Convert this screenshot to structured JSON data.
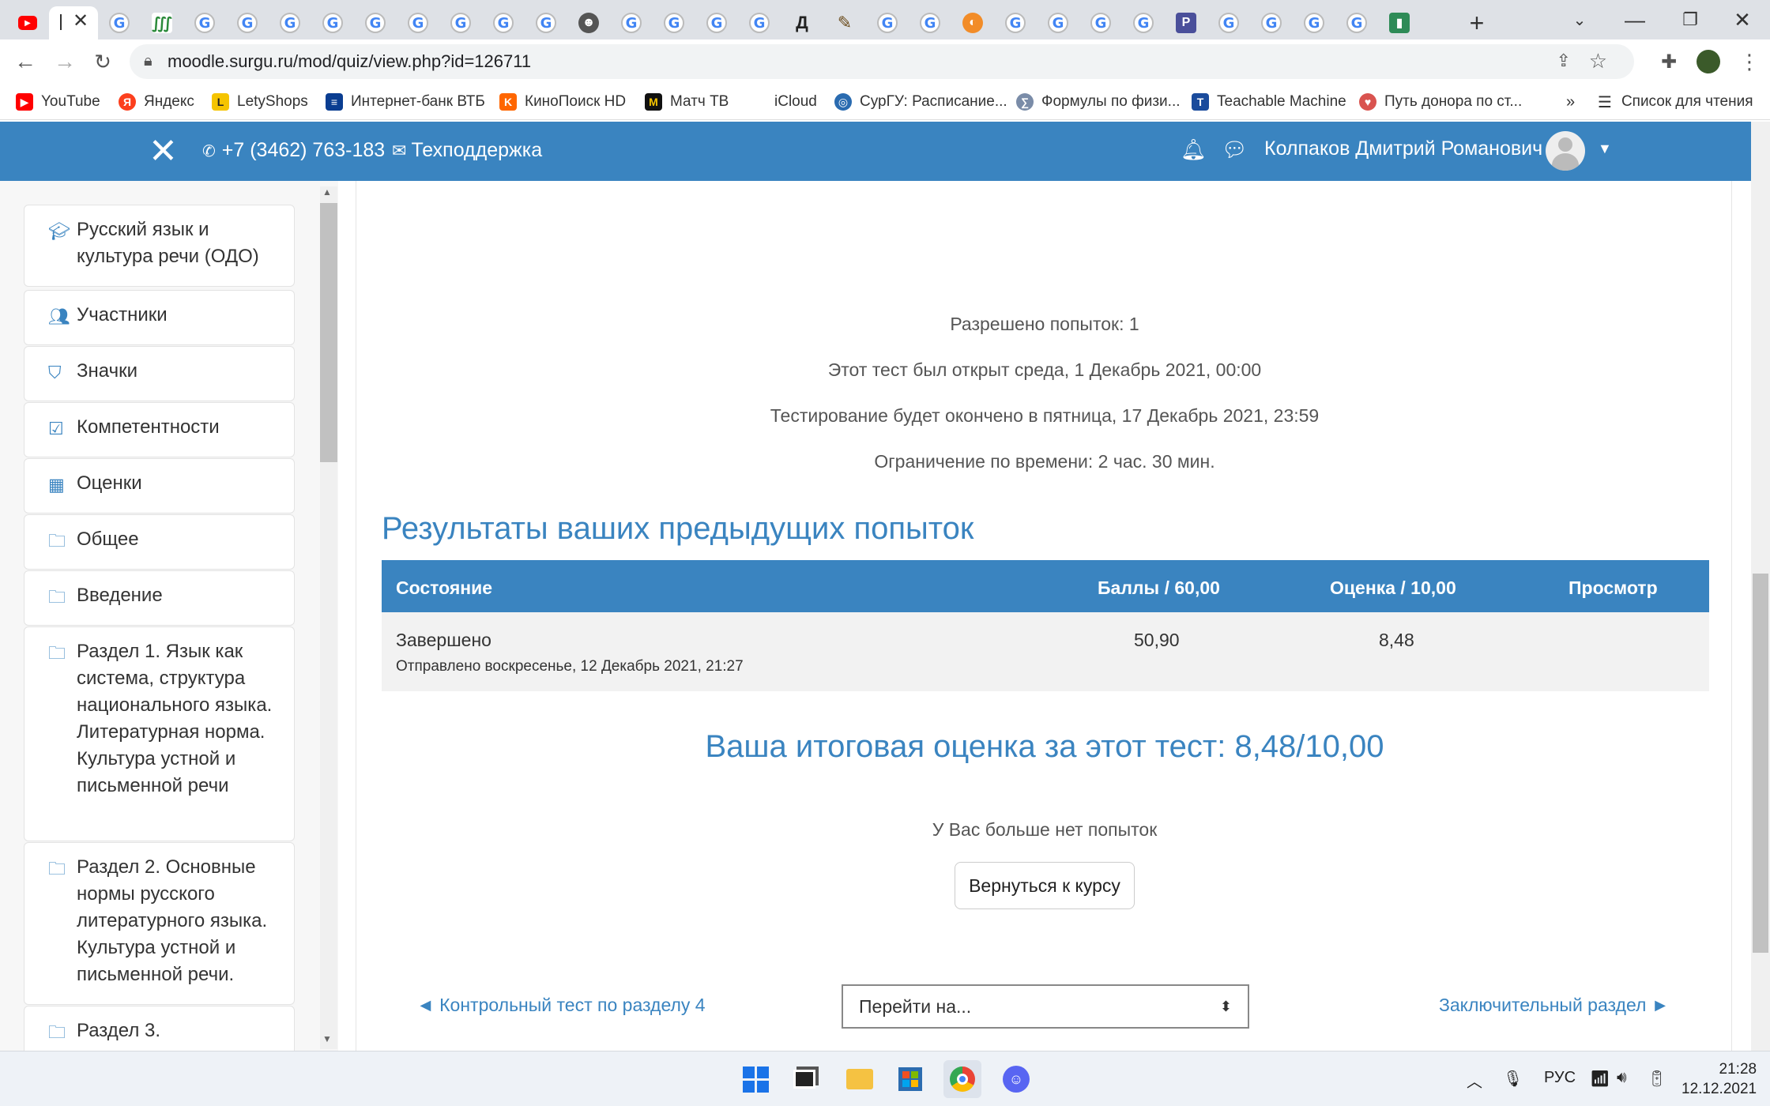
{
  "browser": {
    "url": "moodle.surgu.ru/mod/quiz/view.php?id=126711",
    "new_tab_label": "+"
  },
  "bookmarks": [
    {
      "label": "YouTube",
      "icon": "youtube-icon",
      "color": "#ff0000"
    },
    {
      "label": "Яндекс",
      "icon": "yandex-icon",
      "color": "#fc3f1d"
    },
    {
      "label": "LetyShops",
      "icon": "letyshops-icon",
      "color": "#f5c400"
    },
    {
      "label": "Интернет-банк ВТБ",
      "icon": "vtb-icon",
      "color": "#0a3d91"
    },
    {
      "label": "КиноПоиск HD",
      "icon": "kinopoisk-icon",
      "color": "#ff6600"
    },
    {
      "label": "Матч ТВ",
      "icon": "matchtv-icon",
      "color": "#111111"
    },
    {
      "label": "iCloud",
      "icon": "apple-icon",
      "color": "#666666"
    },
    {
      "label": "СурГУ: Расписание...",
      "icon": "surgu-icon",
      "color": "#2a6bb0"
    },
    {
      "label": "Формулы по физи...",
      "icon": "formula-icon",
      "color": "#7a8ca8"
    },
    {
      "label": "Teachable Machine",
      "icon": "tm-icon",
      "color": "#1a4b9c"
    },
    {
      "label": "Путь донора по ст...",
      "icon": "donor-icon",
      "color": "#d9534f"
    }
  ],
  "bookmarks_more": "»",
  "reading_list": "Список для чтения",
  "header": {
    "phone": "+7 (3462) 763-183",
    "support": "Техподдержка",
    "user_name": "Колпаков Дмитрий Романович"
  },
  "sidebar": {
    "items": [
      {
        "label": "Русский язык и культура речи (ОДО)",
        "icon": "graduation-cap-icon"
      },
      {
        "label": "Участники",
        "icon": "users-icon"
      },
      {
        "label": "Значки",
        "icon": "shield-icon"
      },
      {
        "label": "Компетентности",
        "icon": "checkbox-icon"
      },
      {
        "label": "Оценки",
        "icon": "table-icon"
      },
      {
        "label": "Общее",
        "icon": "folder-icon"
      },
      {
        "label": "Введение",
        "icon": "folder-icon"
      },
      {
        "label": "Раздел 1. Язык как система, структура национального языка. Литературная норма. Культура устной и письменной речи",
        "icon": "folder-icon"
      },
      {
        "label": "Раздел 2. Основные нормы русского литературного языка. Культура устной и письменной речи.",
        "icon": "folder-icon"
      },
      {
        "label": "Раздел 3.",
        "icon": "folder-icon"
      }
    ]
  },
  "quiz_info": {
    "attempts_allowed": "Разрешено попыток: 1",
    "opened": "Этот тест был открыт среда, 1 Декабрь 2021, 00:00",
    "closes": "Тестирование будет окончено в пятница, 17 Декабрь 2021, 23:59",
    "time_limit": "Ограничение по времени: 2 час. 30 мин."
  },
  "results": {
    "heading": "Результаты ваших предыдущих попыток",
    "columns": [
      "Состояние",
      "Баллы / 60,00",
      "Оценка / 10,00",
      "Просмотр"
    ],
    "rows": [
      {
        "state": "Завершено",
        "submitted": "Отправлено воскресенье, 12 Декабрь 2021, 21:27",
        "marks": "50,90",
        "grade": "8,48",
        "review": ""
      }
    ]
  },
  "final_grade": "Ваша итоговая оценка за этот тест: 8,48/10,00",
  "no_more_attempts": "У Вас больше нет попыток",
  "back_button": "Вернуться к курсу",
  "nav": {
    "prev": "◄ Контрольный тест по разделу 4",
    "jump_placeholder": "Перейти на...",
    "next": "Заключительный раздел ►"
  },
  "taskbar": {
    "lang": "РУС",
    "time": "21:28",
    "date": "12.12.2021"
  }
}
